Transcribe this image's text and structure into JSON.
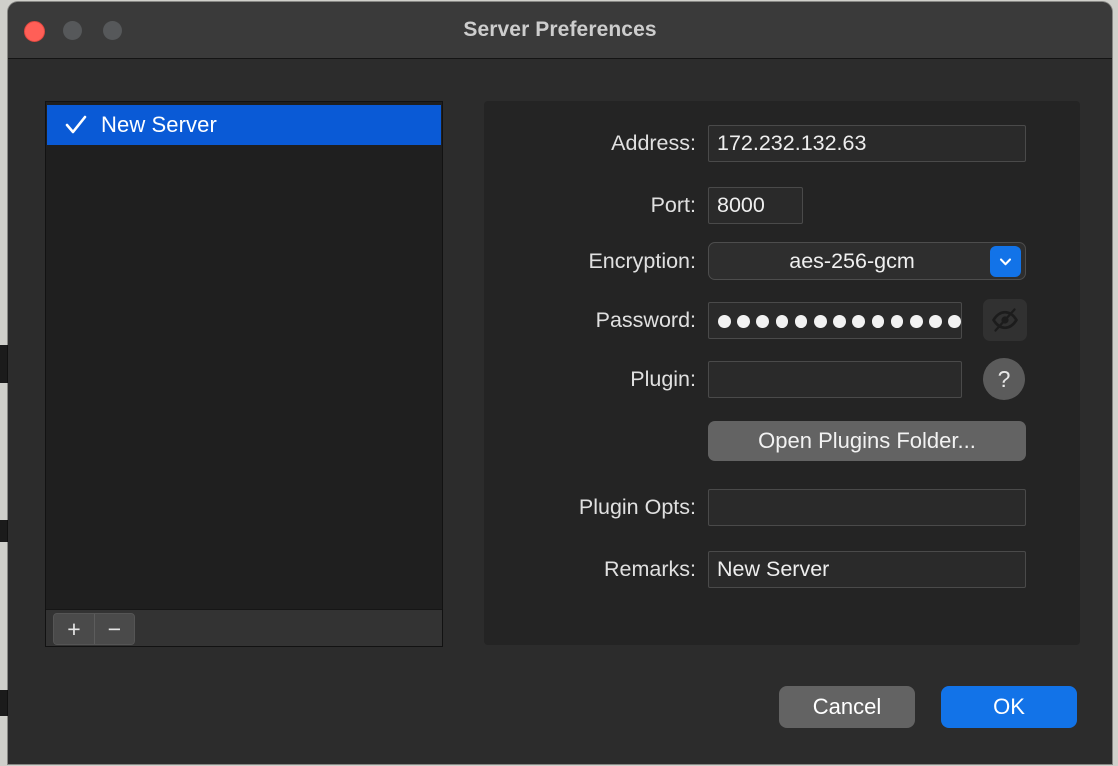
{
  "window": {
    "title": "Server Preferences",
    "traffic_lights": [
      {
        "name": "close",
        "color": "#ff5f57"
      },
      {
        "name": "minimize",
        "color": "#56585a"
      },
      {
        "name": "zoom",
        "color": "#56585a"
      }
    ]
  },
  "sidebar": {
    "servers": [
      {
        "name": "New Server",
        "checked": true,
        "selected": true
      }
    ],
    "toolbar": {
      "add_label": "+",
      "remove_label": "−"
    }
  },
  "form": {
    "address": {
      "label": "Address:",
      "value": "172.232.132.63",
      "placeholder": ""
    },
    "port": {
      "label": "Port:",
      "value": "8000",
      "placeholder": ""
    },
    "encryption": {
      "label": "Encryption:",
      "selected": "aes-256-gcm",
      "options": [
        "aes-256-gcm"
      ]
    },
    "password": {
      "label": "Password:",
      "masked_char_count": 13,
      "value": "",
      "placeholder": "",
      "reveal_icon": "eye-slash-icon"
    },
    "plugin": {
      "label": "Plugin:",
      "value": "",
      "placeholder": "",
      "help_label": "?"
    },
    "open_plugins_folder": {
      "label": "Open Plugins Folder..."
    },
    "plugin_opts": {
      "label": "Plugin Opts:",
      "value": "",
      "placeholder": ""
    },
    "remarks": {
      "label": "Remarks:",
      "value": "New Server",
      "placeholder": ""
    }
  },
  "footer": {
    "cancel_label": "Cancel",
    "ok_label": "OK"
  },
  "colors": {
    "accent_blue": "#1273e8",
    "selection_blue": "#0a5ad6",
    "window_bg": "#2c2c2c",
    "panel_bg": "#242424",
    "list_bg": "#1f1f1f",
    "titlebar_bg": "#3a3a3a"
  }
}
